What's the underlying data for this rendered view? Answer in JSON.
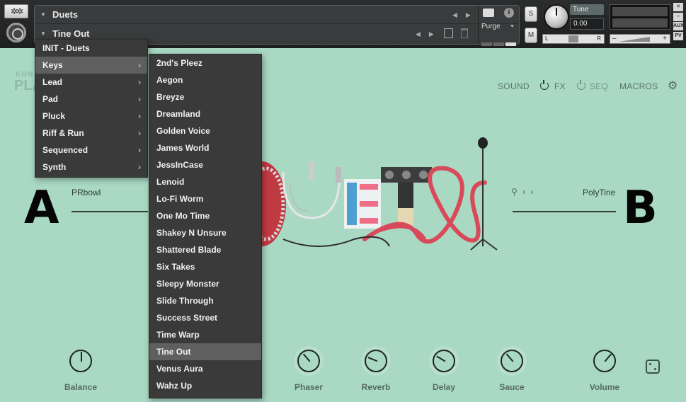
{
  "header": {
    "tool_icon_label": "✲✲",
    "rack_title": "Duets",
    "preset_name": "Tine Out",
    "purge_label": "Purge",
    "solo_label": "S",
    "mute_label": "M",
    "tune_label": "Tune",
    "tune_value": "0.00",
    "pan_left": "L",
    "pan_right": "R",
    "vol_minus": "–",
    "vol_plus": "+",
    "side_buttons": [
      "✕",
      "–",
      "AUX",
      "PV"
    ]
  },
  "brand": {
    "small": "KON",
    "large": "PLA"
  },
  "nav": {
    "sound": "SOUND",
    "fx": "FX",
    "seq": "SEQ",
    "macros": "MACROS"
  },
  "slots": {
    "a": {
      "letter": "A",
      "name": "PRbowl"
    },
    "b": {
      "letter": "B",
      "name": "PolyTine",
      "icons": "⚲ ‹ ›"
    }
  },
  "knobs": [
    {
      "label": "Balance",
      "value": 0.5
    },
    {
      "label": "Phaser",
      "value": 0.35
    },
    {
      "label": "Reverb",
      "value": 0.25
    },
    {
      "label": "Delay",
      "value": 0.28
    },
    {
      "label": "Sauce",
      "value": 0.35
    },
    {
      "label": "Volume",
      "value": 0.65
    }
  ],
  "menu_categories": [
    {
      "label": "INIT - Duets",
      "submenu": false
    },
    {
      "label": "Keys",
      "submenu": true,
      "selected": true
    },
    {
      "label": "Lead",
      "submenu": true
    },
    {
      "label": "Pad",
      "submenu": true
    },
    {
      "label": "Pluck",
      "submenu": true
    },
    {
      "label": "Riff & Run",
      "submenu": true
    },
    {
      "label": "Sequenced",
      "submenu": true
    },
    {
      "label": "Synth",
      "submenu": true
    }
  ],
  "menu_presets": [
    {
      "label": "2nd's Pleez"
    },
    {
      "label": "Aegon"
    },
    {
      "label": "Breyze"
    },
    {
      "label": "Dreamland"
    },
    {
      "label": "Golden Voice"
    },
    {
      "label": "James World"
    },
    {
      "label": "JessInCase"
    },
    {
      "label": "Lenoid"
    },
    {
      "label": "Lo-Fi Worm"
    },
    {
      "label": "One Mo Time"
    },
    {
      "label": "Shakey N Unsure"
    },
    {
      "label": "Shattered Blade"
    },
    {
      "label": "Six Takes"
    },
    {
      "label": "Sleepy Monster"
    },
    {
      "label": "Slide Through"
    },
    {
      "label": "Success Street"
    },
    {
      "label": "Time Warp"
    },
    {
      "label": "Tine Out",
      "selected": true
    },
    {
      "label": "Venus Aura"
    },
    {
      "label": "Wahz Up"
    }
  ],
  "colors": {
    "background": "#a9d8c3",
    "menu_bg": "#3a3a3a",
    "menu_selected": "#5f5f5f",
    "string_red": "#d84a5a"
  }
}
